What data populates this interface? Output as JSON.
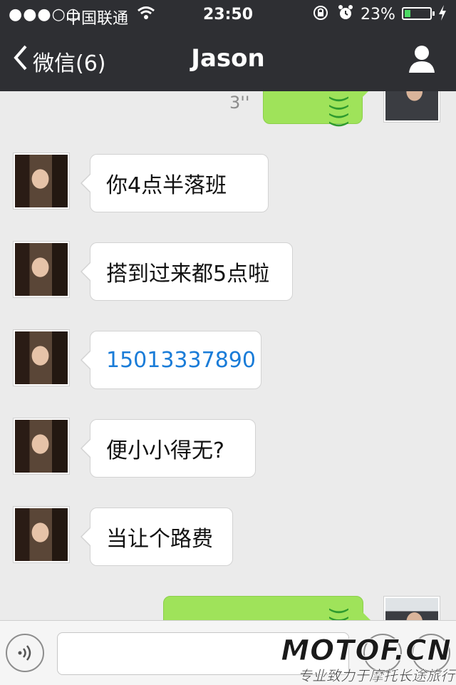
{
  "status_bar": {
    "signal": "●●●○○",
    "carrier": "中国联通",
    "time": "23:50",
    "battery_percent": "23%",
    "battery_level": 0.23,
    "icons": [
      "signal-dots-icon",
      "wifi-icon",
      "rotation-lock-icon",
      "alarm-icon",
      "battery-icon",
      "charging-bolt-icon"
    ]
  },
  "nav": {
    "back_label": "微信(6)",
    "title": "Jason",
    "profile_icon": "person-icon"
  },
  "messages": [
    {
      "side": "right",
      "type": "voice",
      "duration": "3''"
    },
    {
      "side": "left",
      "type": "text",
      "text": "你4点半落班"
    },
    {
      "side": "left",
      "type": "text",
      "text": "搭到过来都5点啦"
    },
    {
      "side": "left",
      "type": "link",
      "text": "15013337890"
    },
    {
      "side": "left",
      "type": "text",
      "text": "便小小得无?"
    },
    {
      "side": "left",
      "type": "text",
      "text": "当让个路费"
    },
    {
      "side": "right",
      "type": "voice",
      "duration": ""
    }
  ],
  "input_bar": {
    "voice_icon": "voice-input-icon",
    "input_value": "",
    "emoji_icon": "emoji-icon",
    "more_icon": "plus-icon"
  },
  "watermark": {
    "logo": "MOTOF.CN",
    "tagline": "专业致力于摩托长途旅行"
  },
  "colors": {
    "bar": "#2e2f33",
    "chat_bg": "#ebebeb",
    "green_bubble": "#9fe35a",
    "link": "#1a7cd8"
  }
}
